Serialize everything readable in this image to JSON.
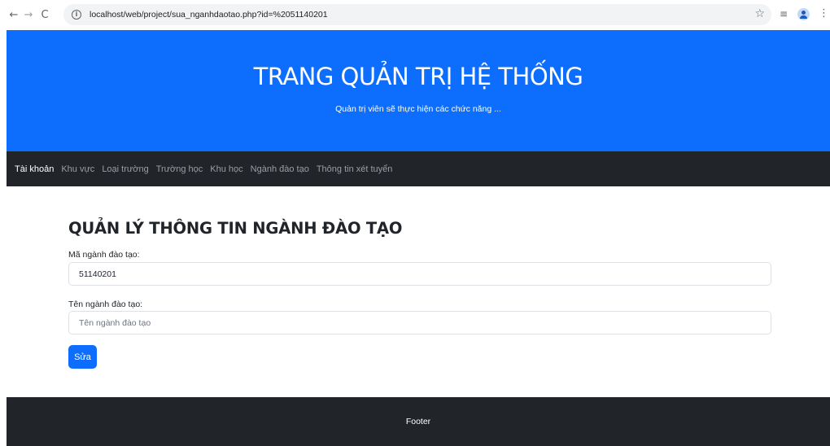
{
  "browser": {
    "back_glyph": "←",
    "forward_glyph": "→",
    "reload_glyph": "C",
    "info_glyph": "i",
    "url": "localhost/web/project/sua_nganhdaotao.php?id=%2051140201",
    "bookmark_glyph": "☆",
    "extensions_glyph": "≡",
    "menu_glyph": "⋮"
  },
  "banner": {
    "title": "TRANG QUẢN TRỊ HỆ THỐNG",
    "subtitle": "Quản trị viên sẽ thực hiện các chức năng ..."
  },
  "nav": {
    "items": [
      {
        "label": "Tài khoản"
      },
      {
        "label": "Khu vực"
      },
      {
        "label": "Loại trường"
      },
      {
        "label": "Trường học"
      },
      {
        "label": "Khu học"
      },
      {
        "label": "Ngành đào tạo"
      },
      {
        "label": "Thông tin xét tuyển"
      }
    ]
  },
  "form": {
    "heading": "QUẢN LÝ THÔNG TIN NGÀNH ĐÀO TẠO",
    "code_label": "Mã ngành đào tạo:",
    "code_value": "51140201",
    "name_label": "Tên ngành đào tạo:",
    "name_value": "",
    "name_placeholder": "Tên ngành đào tạo",
    "submit_label": "Sửa"
  },
  "footer": {
    "text": "Footer"
  },
  "colors": {
    "primary": "#0d6efd",
    "dark": "#212529"
  }
}
